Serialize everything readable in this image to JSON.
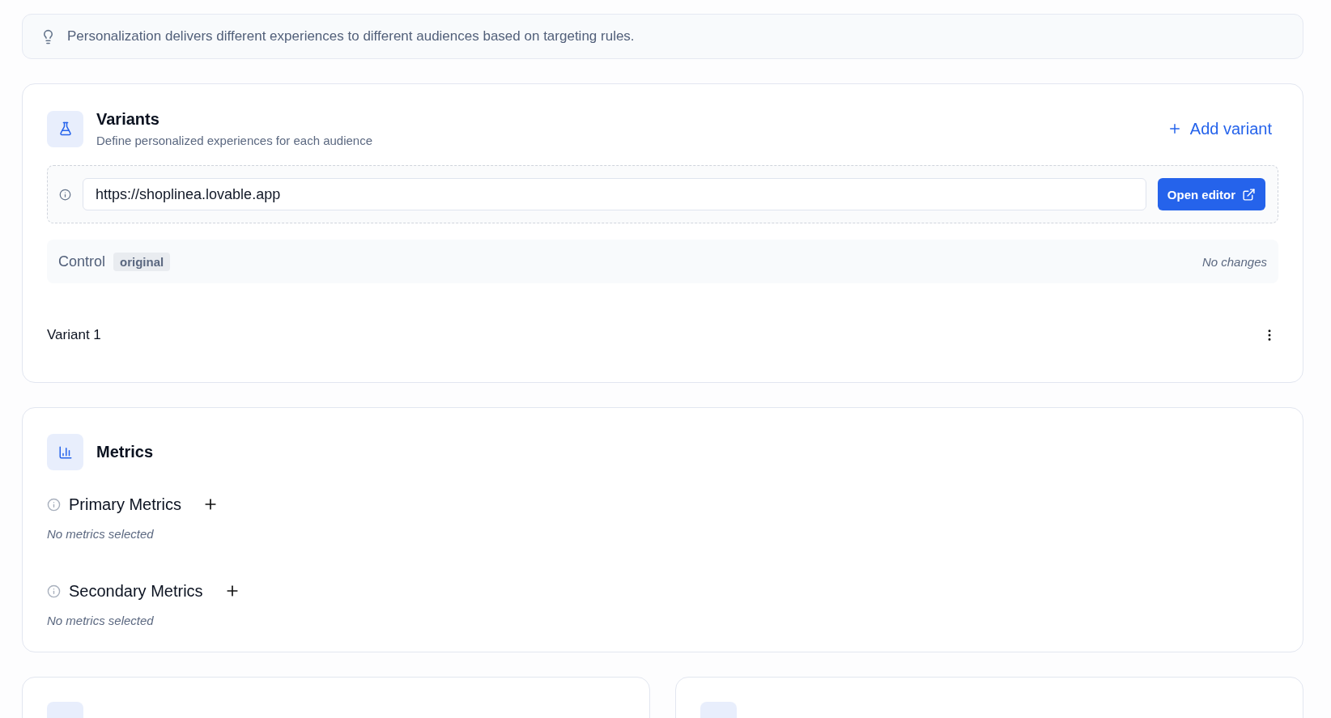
{
  "tip": {
    "text": "Personalization delivers different experiences to different audiences based on targeting rules."
  },
  "variants": {
    "title": "Variants",
    "subtitle": "Define personalized experiences for each audience",
    "add_button": "Add variant",
    "url": "https://shoplinea.lovable.app",
    "open_button": "Open editor",
    "control": {
      "label": "Control",
      "badge": "original",
      "status": "No changes"
    },
    "items": [
      {
        "name": "Variant 1"
      }
    ]
  },
  "metrics": {
    "title": "Metrics",
    "groups": [
      {
        "title": "Primary Metrics",
        "empty": "No metrics selected"
      },
      {
        "title": "Secondary Metrics",
        "empty": "No metrics selected"
      }
    ]
  }
}
